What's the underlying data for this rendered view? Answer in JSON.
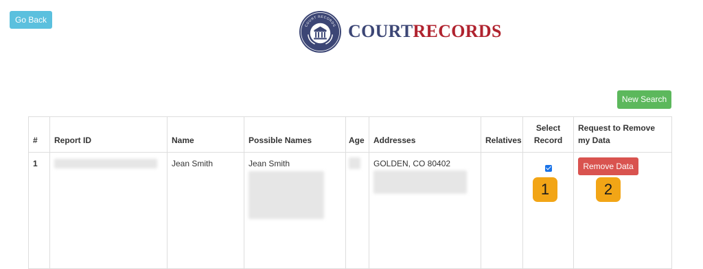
{
  "header": {
    "go_back_label": "Go Back"
  },
  "logo": {
    "brand_part1": "COURT",
    "brand_part2": "RECORDS",
    "seal_text": "COURT RECORDS"
  },
  "actions": {
    "new_search_label": "New Search"
  },
  "table": {
    "headers": {
      "num": "#",
      "report_id": "Report ID",
      "name": "Name",
      "possible_names": "Possible Names",
      "age": "Age",
      "addresses": "Addresses",
      "relatives": "Relatives",
      "select_record": "Select Record",
      "request_remove": "Request to Remove my Data"
    },
    "rows": [
      {
        "num": "1",
        "name": "Jean Smith",
        "possible_name": "Jean Smith",
        "address": "GOLDEN, CO 80402",
        "selected": true,
        "remove_label": "Remove Data"
      }
    ]
  },
  "annotations": [
    "1",
    "2"
  ],
  "colors": {
    "go_back": "#5bc0de",
    "new_search": "#5cb85c",
    "remove": "#d9534f",
    "badge": "#f2a516",
    "brand_navy": "#3c4675",
    "brand_red": "#b0232f"
  }
}
